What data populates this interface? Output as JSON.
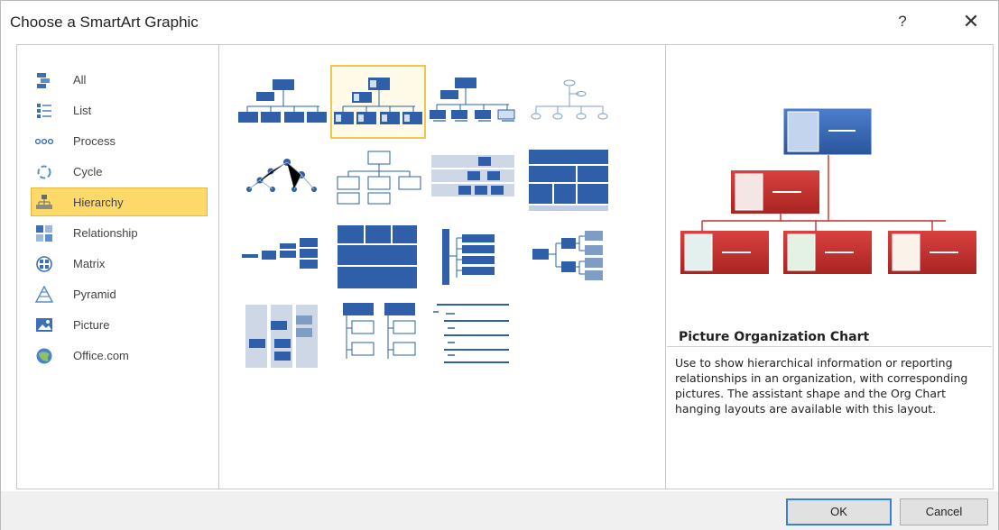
{
  "window": {
    "title": "Choose a SmartArt Graphic",
    "help_label": "?",
    "close_label": "✕"
  },
  "categories": [
    {
      "label": "All",
      "icon": "all-icon"
    },
    {
      "label": "List",
      "icon": "list-icon"
    },
    {
      "label": "Process",
      "icon": "process-icon"
    },
    {
      "label": "Cycle",
      "icon": "cycle-icon"
    },
    {
      "label": "Hierarchy",
      "icon": "hierarchy-icon",
      "selected": true
    },
    {
      "label": "Relationship",
      "icon": "relationship-icon"
    },
    {
      "label": "Matrix",
      "icon": "matrix-icon"
    },
    {
      "label": "Pyramid",
      "icon": "pyramid-icon"
    },
    {
      "label": "Picture",
      "icon": "picture-icon"
    },
    {
      "label": "Office.com",
      "icon": "office-com-icon"
    }
  ],
  "layouts_selected_index": 1,
  "preview": {
    "title": "Picture Organization Chart",
    "description": "Use to show hierarchical information or reporting relationships in an organization, with corresponding pictures. The assistant shape and the Org Chart hanging layouts are available with this layout."
  },
  "buttons": {
    "ok": "OK",
    "cancel": "Cancel"
  },
  "colors": {
    "selection": "#fdd96a",
    "accent_blue": "#2e5fa8",
    "accent_red": "#c0302f"
  }
}
